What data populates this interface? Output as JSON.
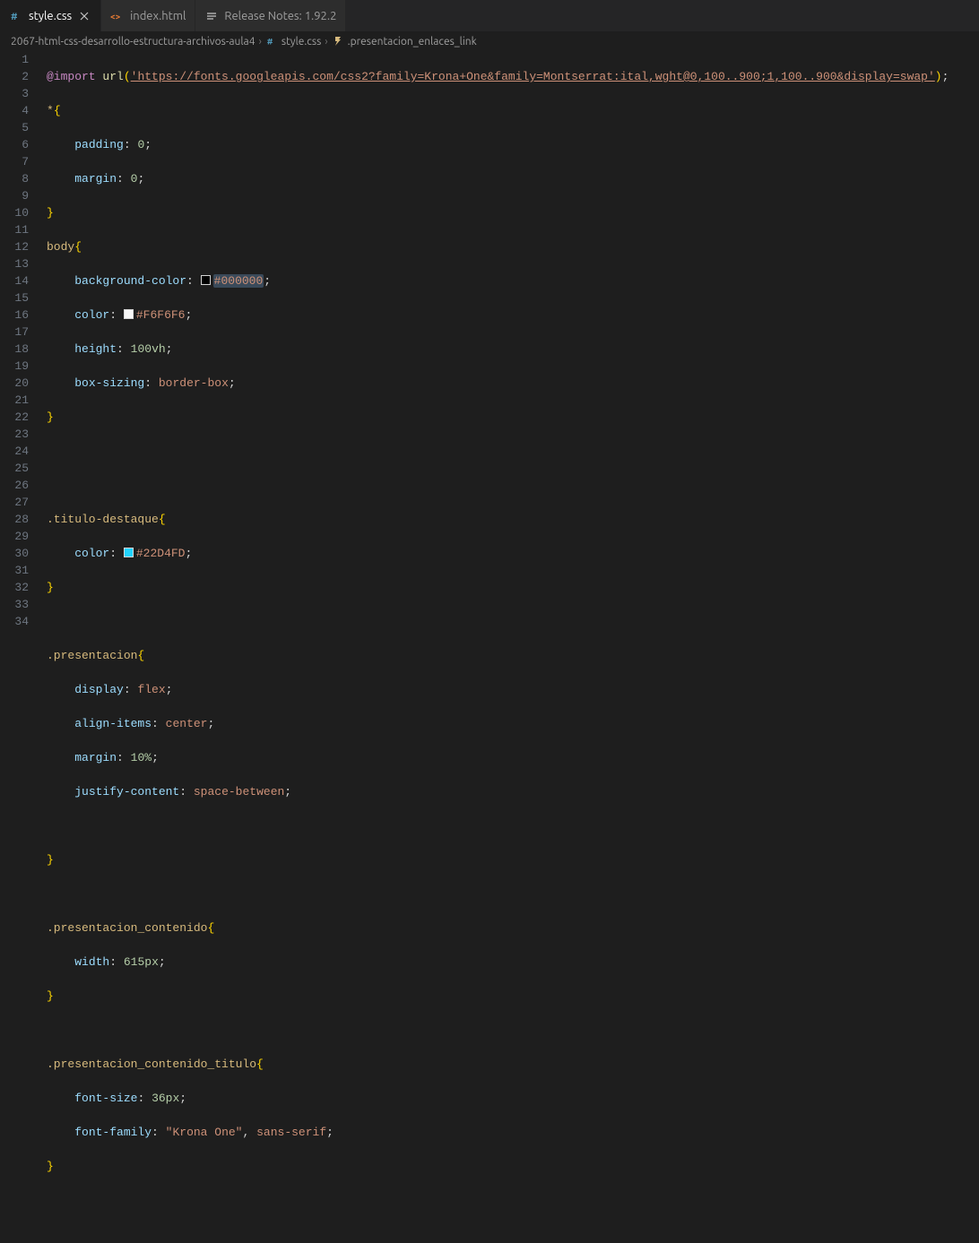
{
  "tabs": [
    {
      "label": "style.css",
      "active": true,
      "icon": "css-file-icon"
    },
    {
      "label": "index.html",
      "active": false,
      "icon": "html-file-icon"
    },
    {
      "label": "Release Notes: 1.92.2",
      "active": false,
      "icon": "release-notes-icon"
    }
  ],
  "breadcrumb": {
    "folder": "2067-html-css-desarrollo-estructura-archivos-aula4",
    "file": "style.css",
    "symbol": ".presentacion_enlaces_link"
  },
  "code": {
    "lines": 34,
    "import_url": "'https://fonts.googleapis.com/css2?family=Krona+One&family=Montserrat:ital,wght@0,100..900;1,100..900&display=swap'",
    "star_rules": {
      "padding": "0",
      "margin": "0"
    },
    "body_rules": {
      "background_color": "#000000",
      "color": "#F6F6F6",
      "height_num": "100",
      "height_unit": "vh",
      "box_sizing": "border-box"
    },
    "titulo_destaque": {
      "color": "#22D4FD"
    },
    "presentacion": {
      "display": "flex",
      "align_items": "center",
      "margin_num": "10",
      "margin_unit": "%",
      "justify_content": "space-between"
    },
    "presentacion_contenido": {
      "width_num": "615",
      "width_unit": "px"
    },
    "presentacion_contenido_titulo": {
      "font_size_num": "36",
      "font_size_unit": "px",
      "font_family": "\"Krona One\"",
      "font_family_fallback": "sans-serif"
    },
    "selectors": {
      "star": "*",
      "body": "body",
      "titulo": ".titulo-destaque",
      "pres": ".presentacion",
      "pres_cont": ".presentacion_contenido",
      "pres_cont_tit": ".presentacion_contenido_titulo"
    },
    "keywords": {
      "import": "@import",
      "url": "url",
      "padding": "padding",
      "margin": "margin",
      "bgcolor": "background-color",
      "color": "color",
      "height": "height",
      "boxsizing": "box-sizing",
      "display": "display",
      "alignitems": "align-items",
      "justify": "justify-content",
      "width": "width",
      "fontsize": "font-size",
      "fontfamily": "font-family"
    }
  }
}
